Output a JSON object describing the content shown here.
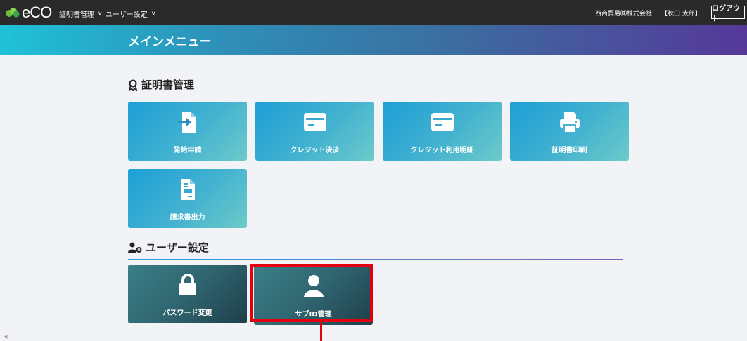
{
  "topbar": {
    "logo_text": "eCO",
    "nav": [
      {
        "label": "証明書管理"
      },
      {
        "label": "ユーザー設定"
      }
    ],
    "company": "西商貿易㈱株式会社",
    "user": "【秋田 太郎】",
    "logout_label": "ログアウト"
  },
  "banner": {
    "title": "メインメニュー"
  },
  "certificate_section": {
    "title": "証明書管理",
    "tiles": [
      {
        "label": "発給申請",
        "icon": "file-arrow-icon"
      },
      {
        "label": "クレジット決済",
        "icon": "credit-card-icon"
      },
      {
        "label": "クレジット利用明細",
        "icon": "credit-card-icon"
      },
      {
        "label": "証明書印刷",
        "icon": "printer-icon"
      },
      {
        "label": "請求書出力",
        "icon": "invoice-icon"
      }
    ]
  },
  "user_section": {
    "title": "ユーザー設定",
    "tiles": [
      {
        "label": "パスワード変更",
        "icon": "lock-icon"
      },
      {
        "label": "サブID管理",
        "icon": "user-icon"
      }
    ]
  },
  "colors": {
    "topbar": "#2a2a2a",
    "tile_light": "#1d9fd6",
    "tile_dark": "#2f6570",
    "highlight": "#e4000f"
  }
}
